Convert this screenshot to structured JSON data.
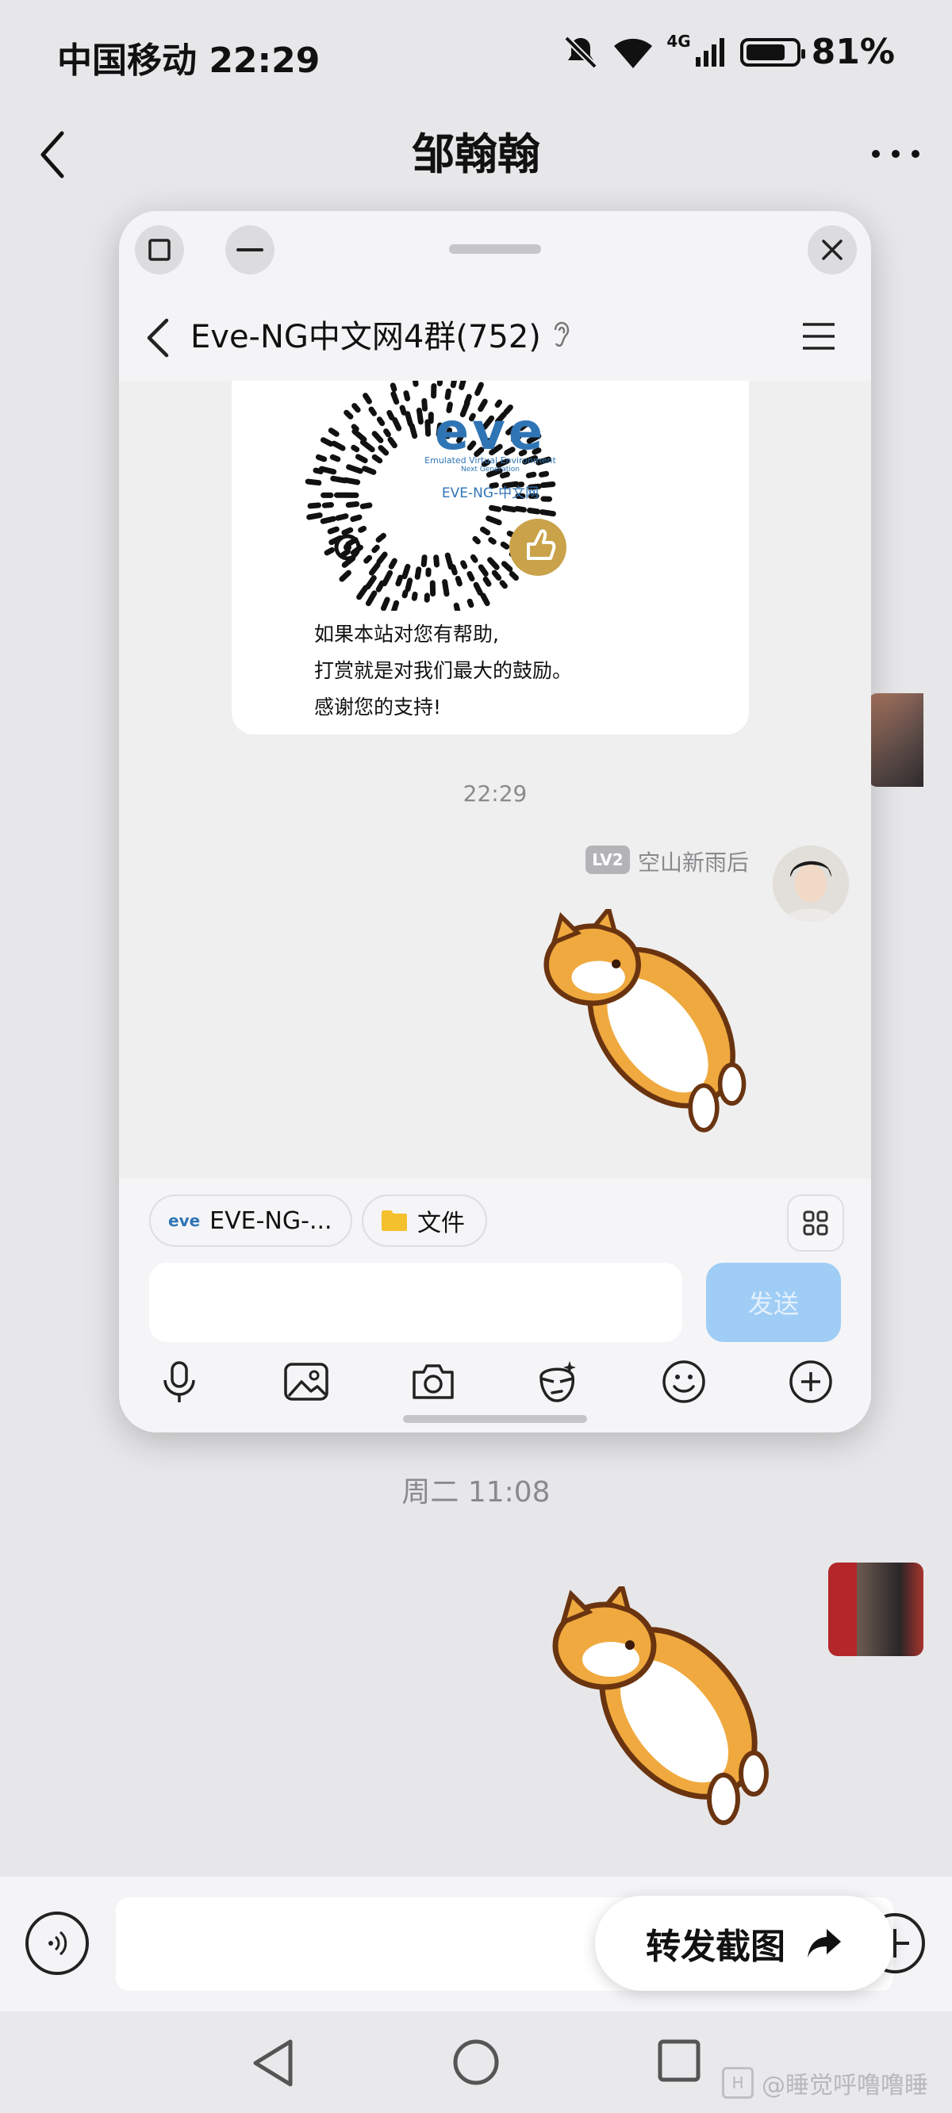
{
  "status_bar": {
    "carrier_time": "中国移动 22:29",
    "network": "4G",
    "battery": "81%",
    "battery_level": 0.81
  },
  "header": {
    "title": "邹翰翰"
  },
  "background_chat": {
    "timestamp": "周二 11:08"
  },
  "bottom_bar": {
    "forward_label": "转发截图"
  },
  "floating_window": {
    "group_title": "Eve-NG中文网4群(752)",
    "qr_card": {
      "logo_text": "eve",
      "logo_subtitle": "Emulated Virtual Environment",
      "logo_subtitle2": "Next Generation",
      "brand": "EVE-NG-中文网",
      "lines": [
        "如果本站对您有帮助,",
        "打赏就是对我们最大的鼓励。",
        "感谢您的支持!"
      ]
    },
    "message_time": "22:29",
    "sender": {
      "level": "LV2",
      "name": "空山新雨后"
    },
    "chips": {
      "chip1": "EVE-NG-...",
      "chip2": "文件"
    },
    "send_label": "发送"
  },
  "watermark": {
    "text": "@睡觉呼噜噜睡"
  },
  "icons": [
    "back-icon",
    "more-icon",
    "window-maximize-icon",
    "window-minimize-icon",
    "close-icon",
    "ear-icon",
    "menu-icon",
    "folder-icon",
    "apps-icon",
    "mic-icon",
    "image-icon",
    "camera-icon",
    "sticker-icon",
    "emoji-icon",
    "plus-icon",
    "share-arrow-icon",
    "voice-icon",
    "nav-back-icon",
    "nav-home-icon",
    "nav-recent-icon"
  ],
  "colors": {
    "send_button": "#9fcdf6",
    "folder": "#f5c02e",
    "logo_blue": "#2f75b5"
  }
}
